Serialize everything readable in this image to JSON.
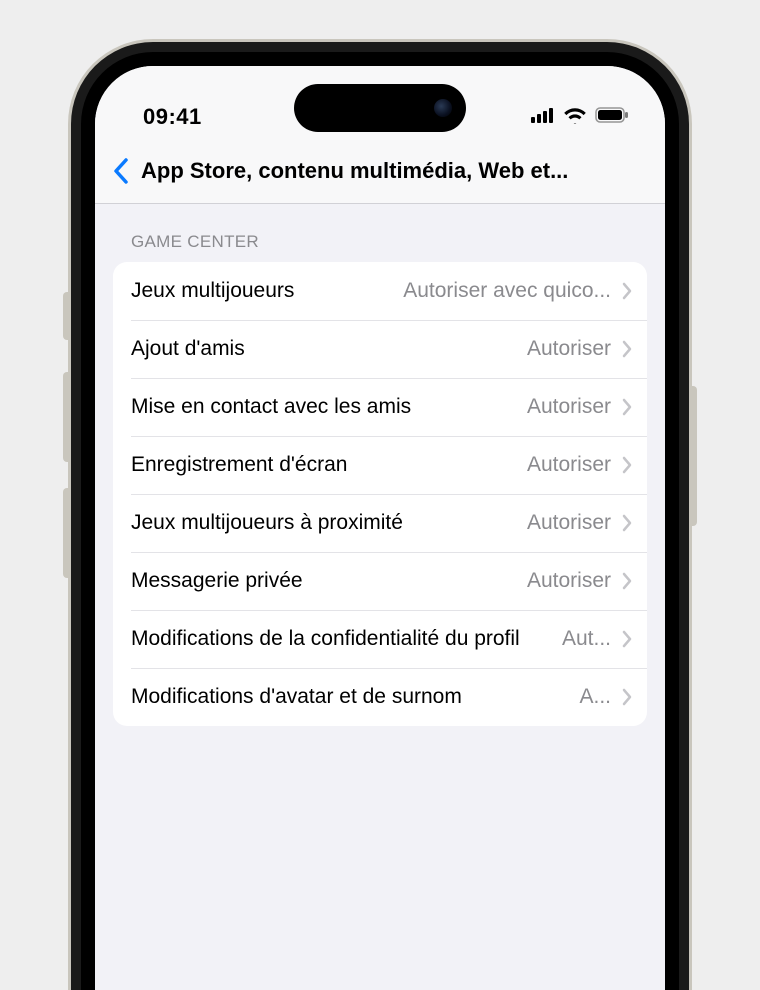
{
  "status": {
    "time": "09:41"
  },
  "nav": {
    "title": "App Store, contenu multimédia, Web et..."
  },
  "section": {
    "header": "GAME CENTER",
    "rows": [
      {
        "label": "Jeux multijoueurs",
        "value": "Autoriser avec quico..."
      },
      {
        "label": "Ajout d'amis",
        "value": "Autoriser"
      },
      {
        "label": "Mise en contact avec les amis",
        "value": "Autoriser"
      },
      {
        "label": "Enregistrement d'écran",
        "value": "Autoriser"
      },
      {
        "label": "Jeux multijoueurs à proximité",
        "value": "Autoriser"
      },
      {
        "label": "Messagerie privée",
        "value": "Autoriser"
      },
      {
        "label": "Modifications de la confidentialité du profil",
        "value": "Aut..."
      },
      {
        "label": "Modifications d'avatar et de surnom",
        "value": "A..."
      }
    ]
  }
}
